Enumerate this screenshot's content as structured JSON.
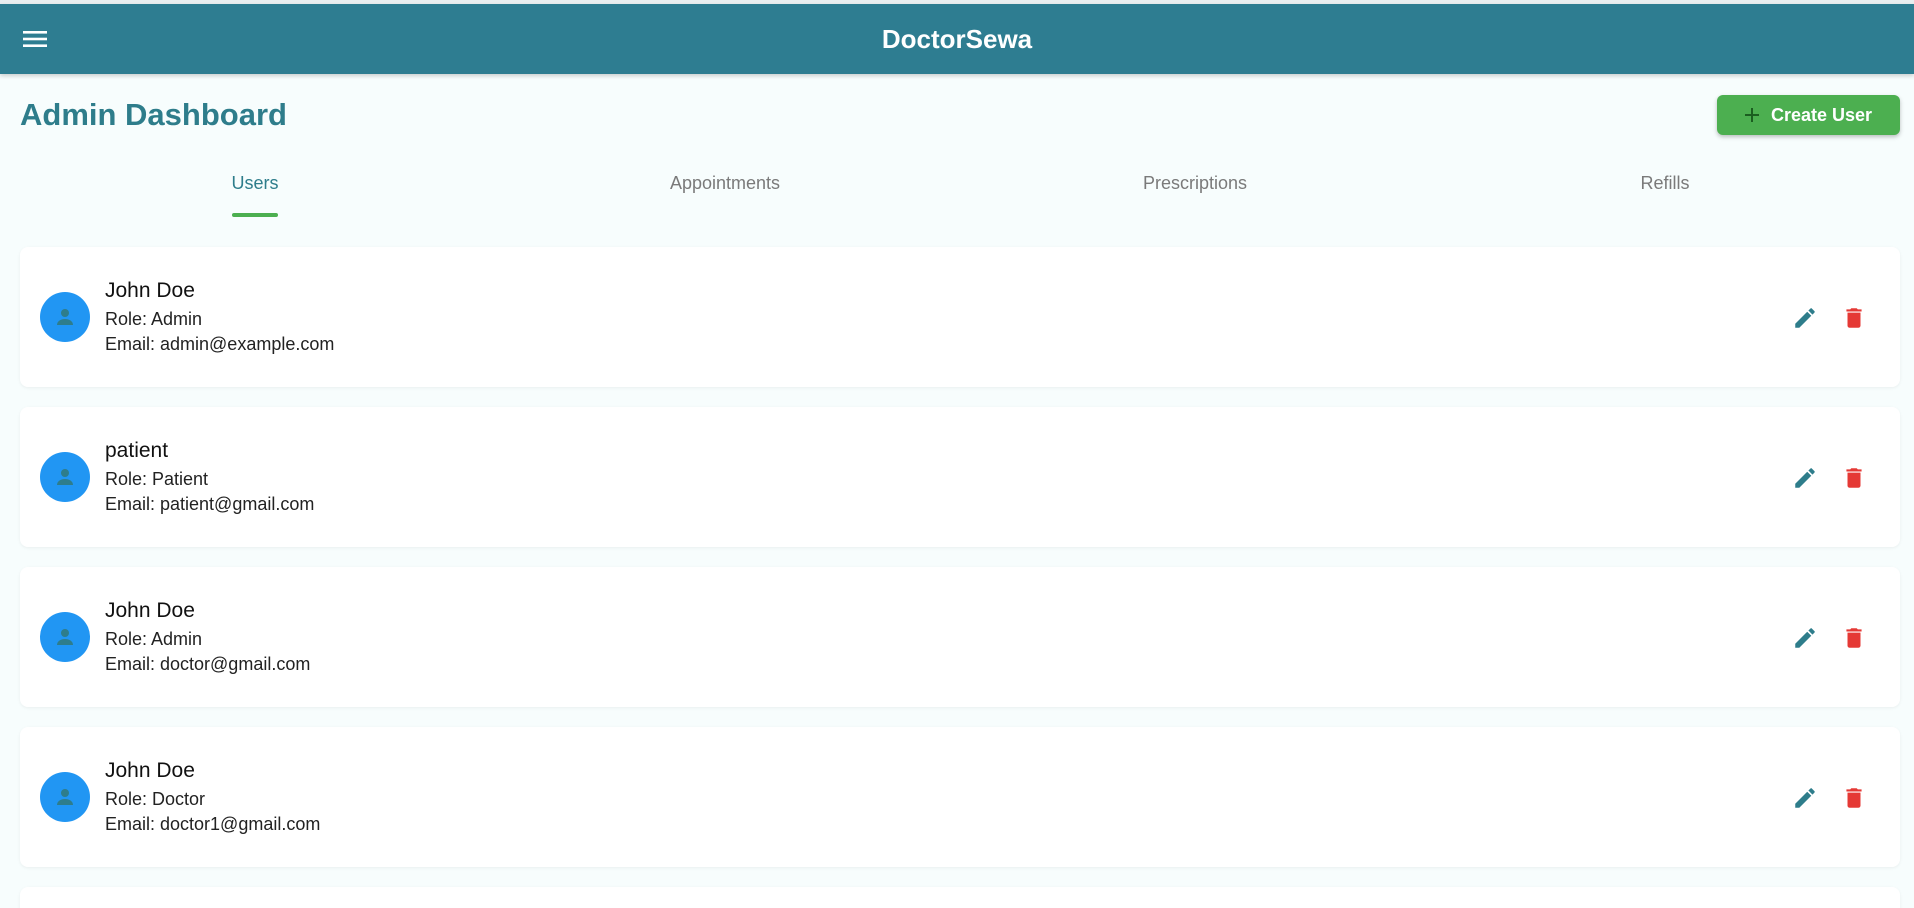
{
  "app": {
    "title": "DoctorSewa",
    "menu_icon": "menu-icon",
    "colors": {
      "appbar": "#2e7d91",
      "accent": "#2e7d8b",
      "success": "#4caf50",
      "avatar": "#2196f3",
      "danger": "#e53935"
    }
  },
  "page": {
    "title": "Admin Dashboard",
    "create_button": {
      "label": "Create User",
      "icon": "plus-icon"
    }
  },
  "tabs": [
    {
      "label": "Users",
      "active": true
    },
    {
      "label": "Appointments",
      "active": false
    },
    {
      "label": "Prescriptions",
      "active": false
    },
    {
      "label": "Refills",
      "active": false
    }
  ],
  "users": [
    {
      "name": "John Doe",
      "role": "Role: Admin",
      "email": "Email: admin@example.com"
    },
    {
      "name": "patient",
      "role": "Role: Patient",
      "email": "Email: patient@gmail.com"
    },
    {
      "name": "John Doe",
      "role": "Role: Admin",
      "email": "Email: doctor@gmail.com"
    },
    {
      "name": "John Doe",
      "role": "Role: Doctor",
      "email": "Email: doctor1@gmail.com"
    }
  ]
}
